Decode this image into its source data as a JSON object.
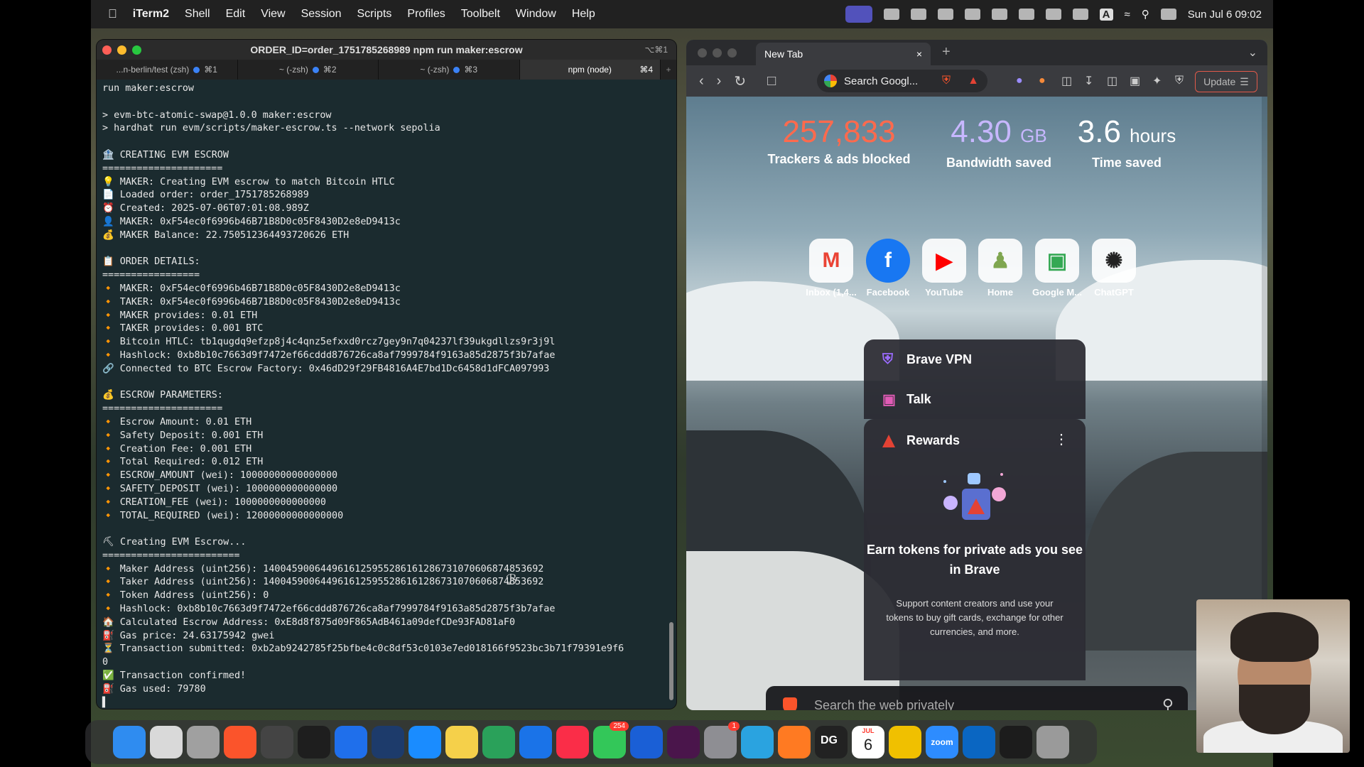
{
  "menubar": {
    "apple": "",
    "items": [
      "iTerm2",
      "Shell",
      "Edit",
      "View",
      "Session",
      "Scripts",
      "Profiles",
      "Toolbelt",
      "Window",
      "Help"
    ],
    "tray_letter": "A",
    "clock": "Sun Jul 6  09:02"
  },
  "iterm": {
    "title": "ORDER_ID=order_1751785268989 npm run maker:escrow",
    "title_shortcut": "⌥⌘1",
    "tabs": [
      {
        "label": "...n-berlin/test (zsh)",
        "key": "⌘1"
      },
      {
        "label": "~ (-zsh)",
        "key": "⌘2"
      },
      {
        "label": "~ (-zsh)",
        "key": "⌘3"
      },
      {
        "label": "npm (node)",
        "key": "⌘4"
      }
    ],
    "new_tab": "+",
    "lines": [
      "run maker:escrow",
      "",
      "> evm-btc-atomic-swap@1.0.0 maker:escrow",
      "> hardhat run evm/scripts/maker-escrow.ts --network sepolia",
      "",
      "🏦 CREATING EVM ESCROW",
      "=====================",
      "💡 MAKER: Creating EVM escrow to match Bitcoin HTLC",
      "📄 Loaded order: order_1751785268989",
      "⏰ Created: 2025-07-06T07:01:08.989Z",
      "👤 MAKER: 0xF54ec0f6996b46B71B8D0c05F8430D2e8eD9413c",
      "💰 MAKER Balance: 22.750512364493720626 ETH",
      "",
      "📋 ORDER DETAILS:",
      "=================",
      "🔸 MAKER: 0xF54ec0f6996b46B71B8D0c05F8430D2e8eD9413c",
      "🔸 TAKER: 0xF54ec0f6996b46B71B8D0c05F8430D2e8eD9413c",
      "🔸 MAKER provides: 0.01 ETH",
      "🔸 TAKER provides: 0.001 BTC",
      "🔸 Bitcoin HTLC: tb1qugdq9efzp8j4c4qnz5efxxd0rcz7gey9n7q04237lf39ukgdllzs9r3j9l",
      "🔸 Hashlock: 0xb8b10c7663d9f7472ef66cddd876726ca8af7999784f9163a85d2875f3b7afae",
      "🔗 Connected to BTC Escrow Factory: 0x46dD29f29FB4816A4E7bd1Dc6458d1dFCA097993",
      "",
      "💰 ESCROW PARAMETERS:",
      "=====================",
      "🔸 Escrow Amount: 0.01 ETH",
      "🔸 Safety Deposit: 0.001 ETH",
      "🔸 Creation Fee: 0.001 ETH",
      "🔸 Total Required: 0.012 ETH",
      "🔸 ESCROW_AMOUNT (wei): 10000000000000000",
      "🔸 SAFETY_DEPOSIT (wei): 1000000000000000",
      "🔸 CREATION_FEE (wei): 1000000000000000",
      "🔸 TOTAL_REQUIRED (wei): 12000000000000000",
      "",
      "⛏ Creating EVM Escrow...",
      "========================",
      "🔸 Maker Address (uint256): 1400459006449616125955286161286731070606874853692",
      "🔸 Taker Address (uint256): 1400459006449616125955286161286731070606874853692",
      "🔸 Token Address (uint256): 0",
      "🔸 Hashlock: 0xb8b10c7663d9f7472ef66cddd876726ca8af7999784f9163a85d2875f3b7afae",
      "🏠 Calculated Escrow Address: 0xE8d8f875d09F865AdB461a09defCDe93FAD81aF0",
      "⛽ Gas price: 24.63175942 gwei",
      "⏳ Transaction submitted: 0xb2ab9242785f25bfbe4c0c8df53c0103e7ed018166f9523bc3b71f79391e9f6",
      "0",
      "✅ Transaction confirmed!",
      "⛽ Gas used: 79780",
      "▌"
    ]
  },
  "brave": {
    "tab_title": "New Tab",
    "tab_close": "×",
    "new_tab": "+",
    "omnibox_text": "Search Googl...",
    "update_label": "Update",
    "stats": [
      {
        "value": "257,833",
        "unit": "",
        "label": "Trackers & ads blocked",
        "color": "#ff6a4d"
      },
      {
        "value": "4.30",
        "unit": "GB",
        "label": "Bandwidth saved",
        "color": "#c7b7ff"
      },
      {
        "value": "3.6",
        "unit": "hours",
        "label": "Time saved",
        "color": "#ffffff"
      }
    ],
    "tiles": [
      {
        "label": "Inbox (1,4...",
        "icon": "M",
        "color": "#ea4335"
      },
      {
        "label": "Facebook",
        "icon": "f",
        "color": "#1877f2"
      },
      {
        "label": "YouTube",
        "icon": "▶",
        "color": "#ff0000"
      },
      {
        "label": "Home",
        "icon": "♟",
        "color": "#7fa650"
      },
      {
        "label": "Google M...",
        "icon": "▣",
        "color": "#34a853"
      },
      {
        "label": "ChatGPT",
        "icon": "✺",
        "color": "#222222"
      }
    ],
    "cards": {
      "vpn": "Brave VPN",
      "talk": "Talk",
      "rewards_title": "Rewards",
      "rewards_more": "⋮",
      "rewards_heading": "Earn tokens for private ads you see in Brave",
      "rewards_body": "Support content creators and use your tokens to buy gift cards, exchange for other currencies, and more."
    },
    "search_placeholder": "Search the web privately"
  },
  "dock": {
    "apps": [
      {
        "name": "finder",
        "color": "#2f8cf0"
      },
      {
        "name": "launchpad",
        "color": "#d9d9d9"
      },
      {
        "name": "notes-pad",
        "color": "#a0a0a0"
      },
      {
        "name": "brave",
        "color": "#fb542b"
      },
      {
        "name": "app-gray",
        "color": "#444444"
      },
      {
        "name": "terminal",
        "color": "#1e1e1e"
      },
      {
        "name": "bluetooth",
        "color": "#1f6feb"
      },
      {
        "name": "app-blue",
        "color": "#1d3b6b"
      },
      {
        "name": "app-store",
        "color": "#1a8cff"
      },
      {
        "name": "notes",
        "color": "#f5d04a"
      },
      {
        "name": "app-green",
        "color": "#2aa15a"
      },
      {
        "name": "accessibility",
        "color": "#1a73e8"
      },
      {
        "name": "music",
        "color": "#fa2d48"
      },
      {
        "name": "messages",
        "color": "#33c759",
        "badge": "254"
      },
      {
        "name": "1password",
        "color": "#1a5fd6"
      },
      {
        "name": "slack",
        "color": "#4a154b"
      },
      {
        "name": "system-settings",
        "color": "#8e8e93",
        "badge": "1"
      },
      {
        "name": "telegram",
        "color": "#2aa3e0"
      },
      {
        "name": "sublime",
        "color": "#ff7a22"
      },
      {
        "name": "datagrip",
        "color": "#222222"
      },
      {
        "name": "calendar",
        "color": "#ffffff"
      },
      {
        "name": "photos",
        "color": "#f0c000"
      },
      {
        "name": "zoom",
        "color": "#2d8cff"
      },
      {
        "name": "vscode",
        "color": "#0a66c2"
      },
      {
        "name": "activity-monitor",
        "color": "#1c1c1c"
      },
      {
        "name": "trash",
        "color": "#9a9a9a"
      }
    ],
    "dg_text": "DG",
    "cal_month": "JUL",
    "cal_day": "6",
    "zoom_text": "zoom"
  }
}
